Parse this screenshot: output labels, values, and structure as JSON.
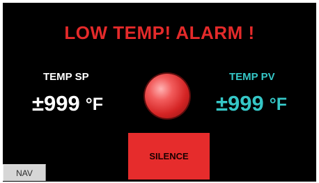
{
  "alarm": {
    "title": "LOW TEMP! ALARM !",
    "light_color": "#e42a2a"
  },
  "setpoint": {
    "label": "TEMP SP",
    "value": "±999",
    "unit": "°F"
  },
  "process_value": {
    "label": "TEMP PV",
    "value": "±999",
    "unit": "°F",
    "color": "#35c6c6"
  },
  "buttons": {
    "silence_label": "SILENCE",
    "nav_label": "NAV"
  }
}
